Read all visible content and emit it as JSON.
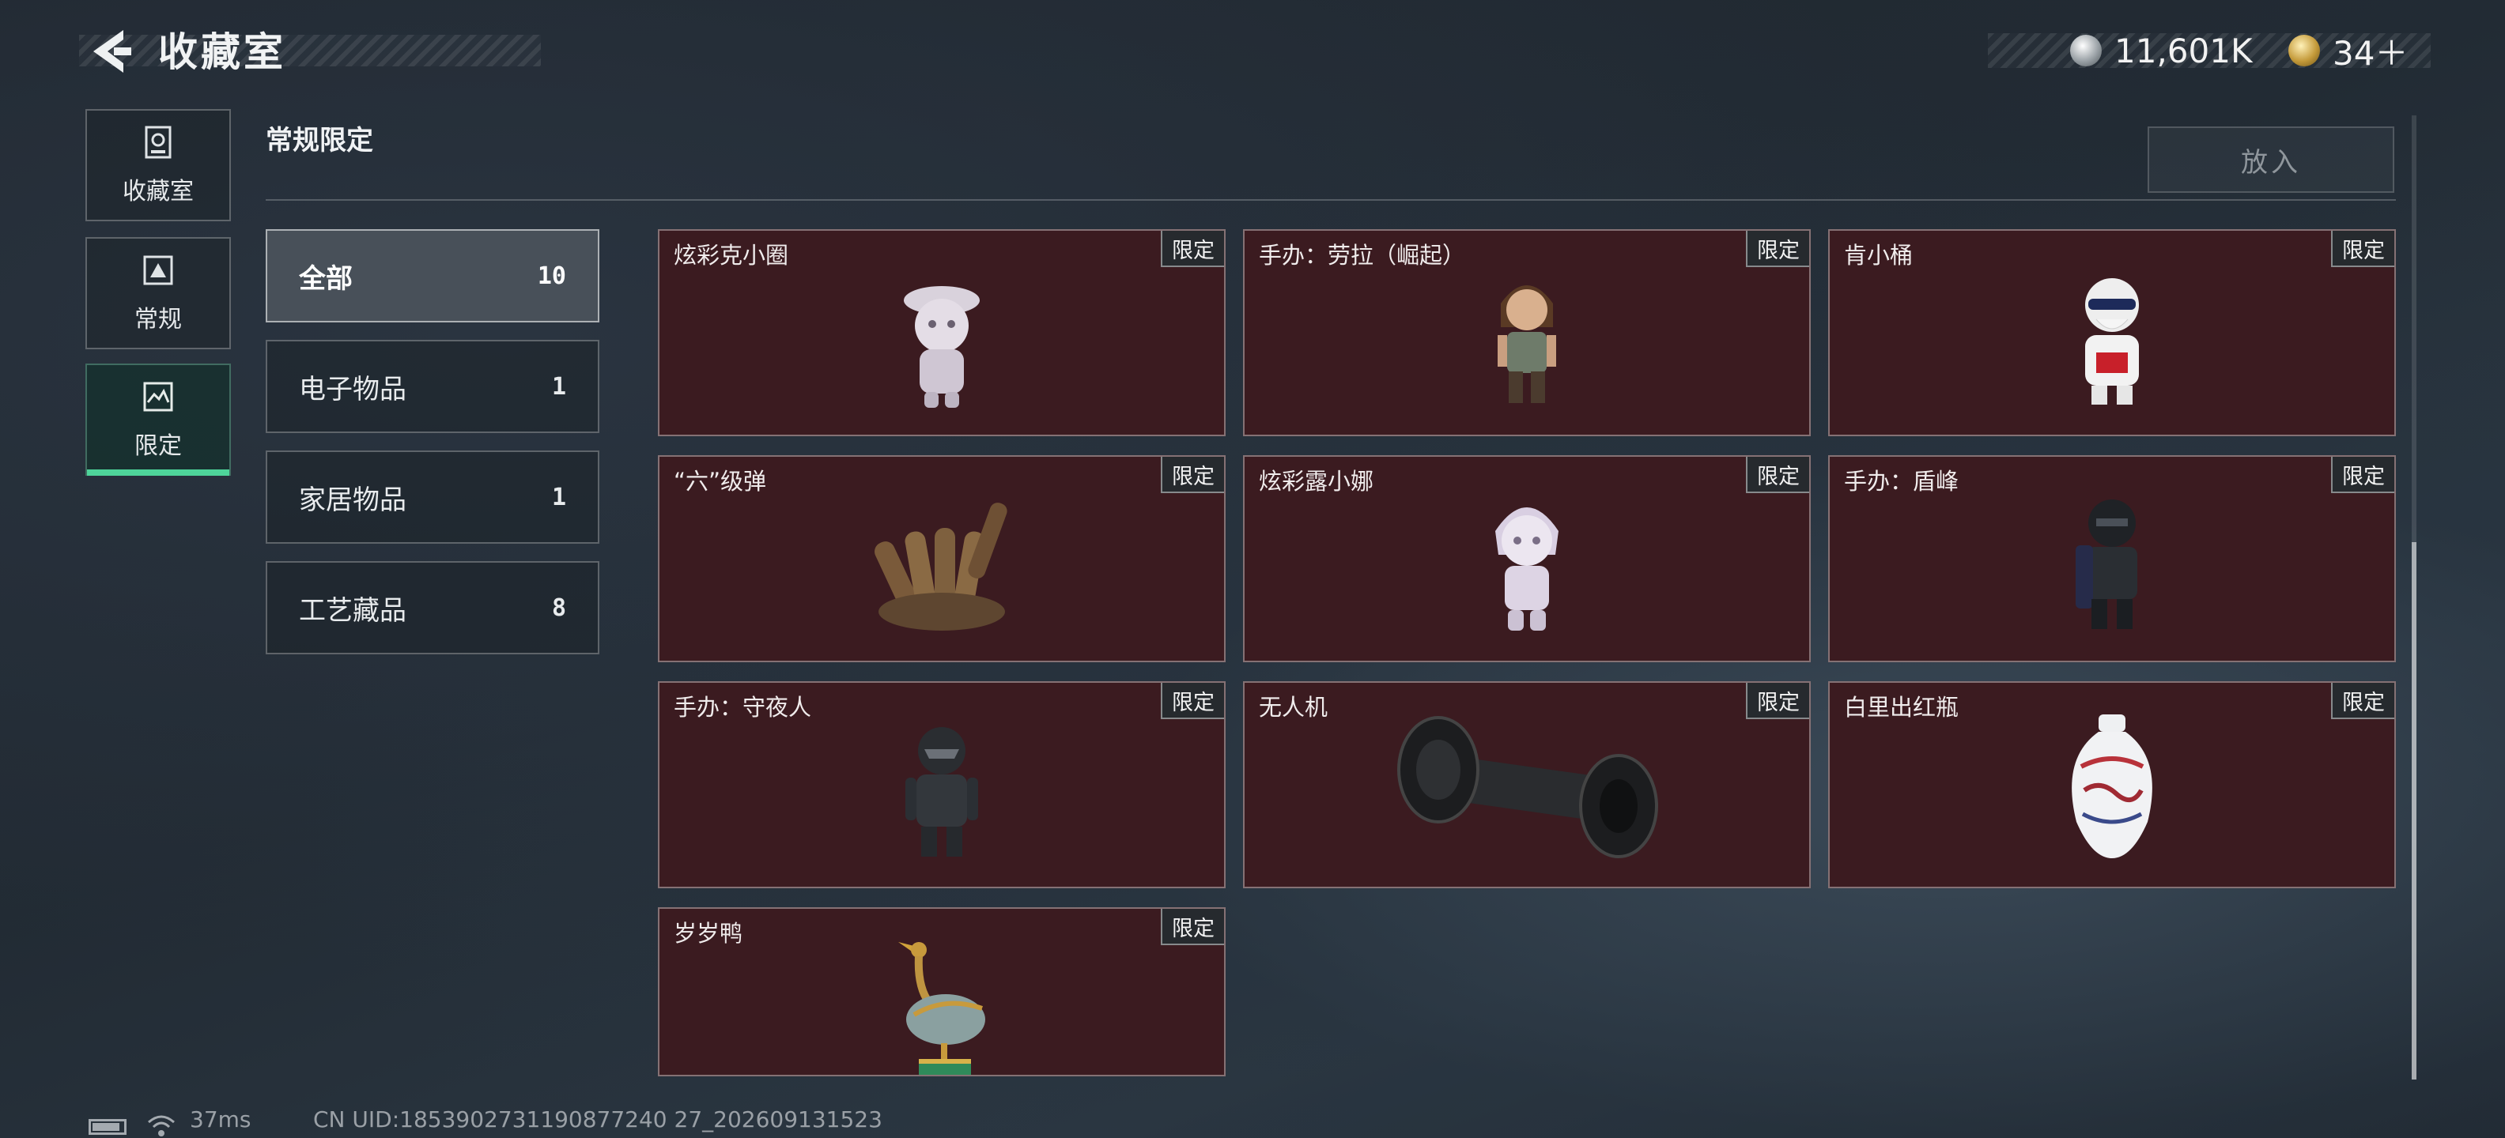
{
  "header": {
    "title": "收藏室",
    "currency_silver": "11,601K",
    "currency_gold": "34＋"
  },
  "nav": {
    "items": [
      {
        "label": "收藏室",
        "icon": "vault-icon"
      },
      {
        "label": "常规",
        "icon": "regular-collection-icon"
      },
      {
        "label": "限定",
        "icon": "limited-collection-icon",
        "active": true
      }
    ]
  },
  "section": {
    "title": "常规限定",
    "put_button": "放入"
  },
  "categories": [
    {
      "label": "全部",
      "count": "10",
      "active": true
    },
    {
      "label": "电子物品",
      "count": "1"
    },
    {
      "label": "家居物品",
      "count": "1"
    },
    {
      "label": "工艺藏品",
      "count": "8"
    }
  ],
  "items": [
    {
      "name": "炫彩克小圈",
      "tag": "限定"
    },
    {
      "name": "手办：劳拉（崛起）",
      "tag": "限定"
    },
    {
      "name": "肯小桶",
      "tag": "限定"
    },
    {
      "name": "“六”级弹",
      "tag": "限定"
    },
    {
      "name": "炫彩露小娜",
      "tag": "限定"
    },
    {
      "name": "手办：盾峰",
      "tag": "限定"
    },
    {
      "name": "手办：守夜人",
      "tag": "限定"
    },
    {
      "name": "无人机",
      "tag": "限定"
    },
    {
      "name": "白里出红瓶",
      "tag": "限定"
    },
    {
      "name": "岁岁鸭",
      "tag": "限定"
    }
  ],
  "footer": {
    "ping": "37ms",
    "uid": "CN UID:1853902731190877240 27_202609131523"
  },
  "colors": {
    "card_bg": "#3b1b20",
    "active_nav_accent": "#4ed49a"
  }
}
